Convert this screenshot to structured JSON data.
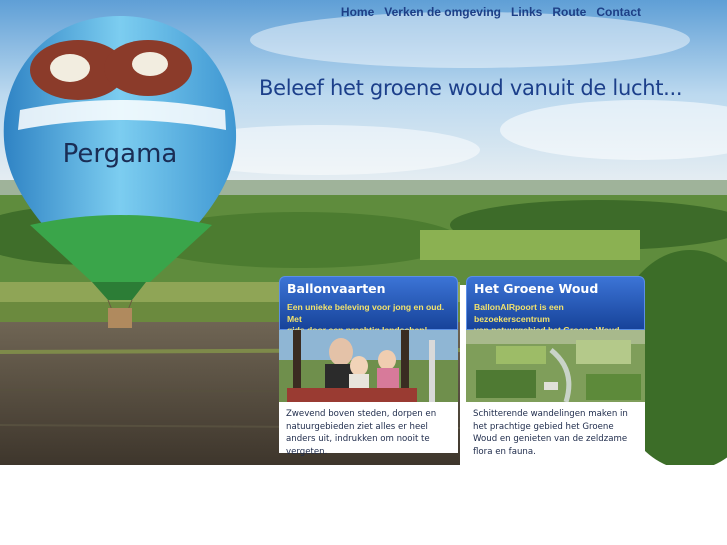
{
  "nav": {
    "items": [
      {
        "label": "Home"
      },
      {
        "label": "Verken de omgeving"
      },
      {
        "label": "Links"
      },
      {
        "label": "Route"
      },
      {
        "label": "Contact"
      }
    ]
  },
  "hero": {
    "headline": "Beleef het groene woud vanuit de lucht...",
    "balloon_label": "Pergama"
  },
  "cards": [
    {
      "title": "Ballonvaarten",
      "subtitle_line1": "Een unieke beleving voor jong en oud. Met",
      "subtitle_line2": "gids door een prachtig landschap!",
      "body": "Zwevend boven steden, dorpen en natuurgebieden ziet alles er heel anders uit, indrukken om nooit te vergeten."
    },
    {
      "title": "Het Groene Woud",
      "subtitle_line1": "BallonAIRpoort is een bezoekerscentrum",
      "subtitle_line2": "van natuurgebied het Groene Woud.",
      "body": "Schitterende wandelingen maken in het prachtige gebied het Groene Woud en genieten van de zeldzame flora en fauna."
    }
  ],
  "colors": {
    "nav_text": "#1d3f86",
    "headline": "#1c3f8a",
    "card_header": "#1f4ea8",
    "card_subtitle": "#f3e36c",
    "balloon_blue": "#5cb8e6",
    "balloon_green": "#3aa54a"
  }
}
